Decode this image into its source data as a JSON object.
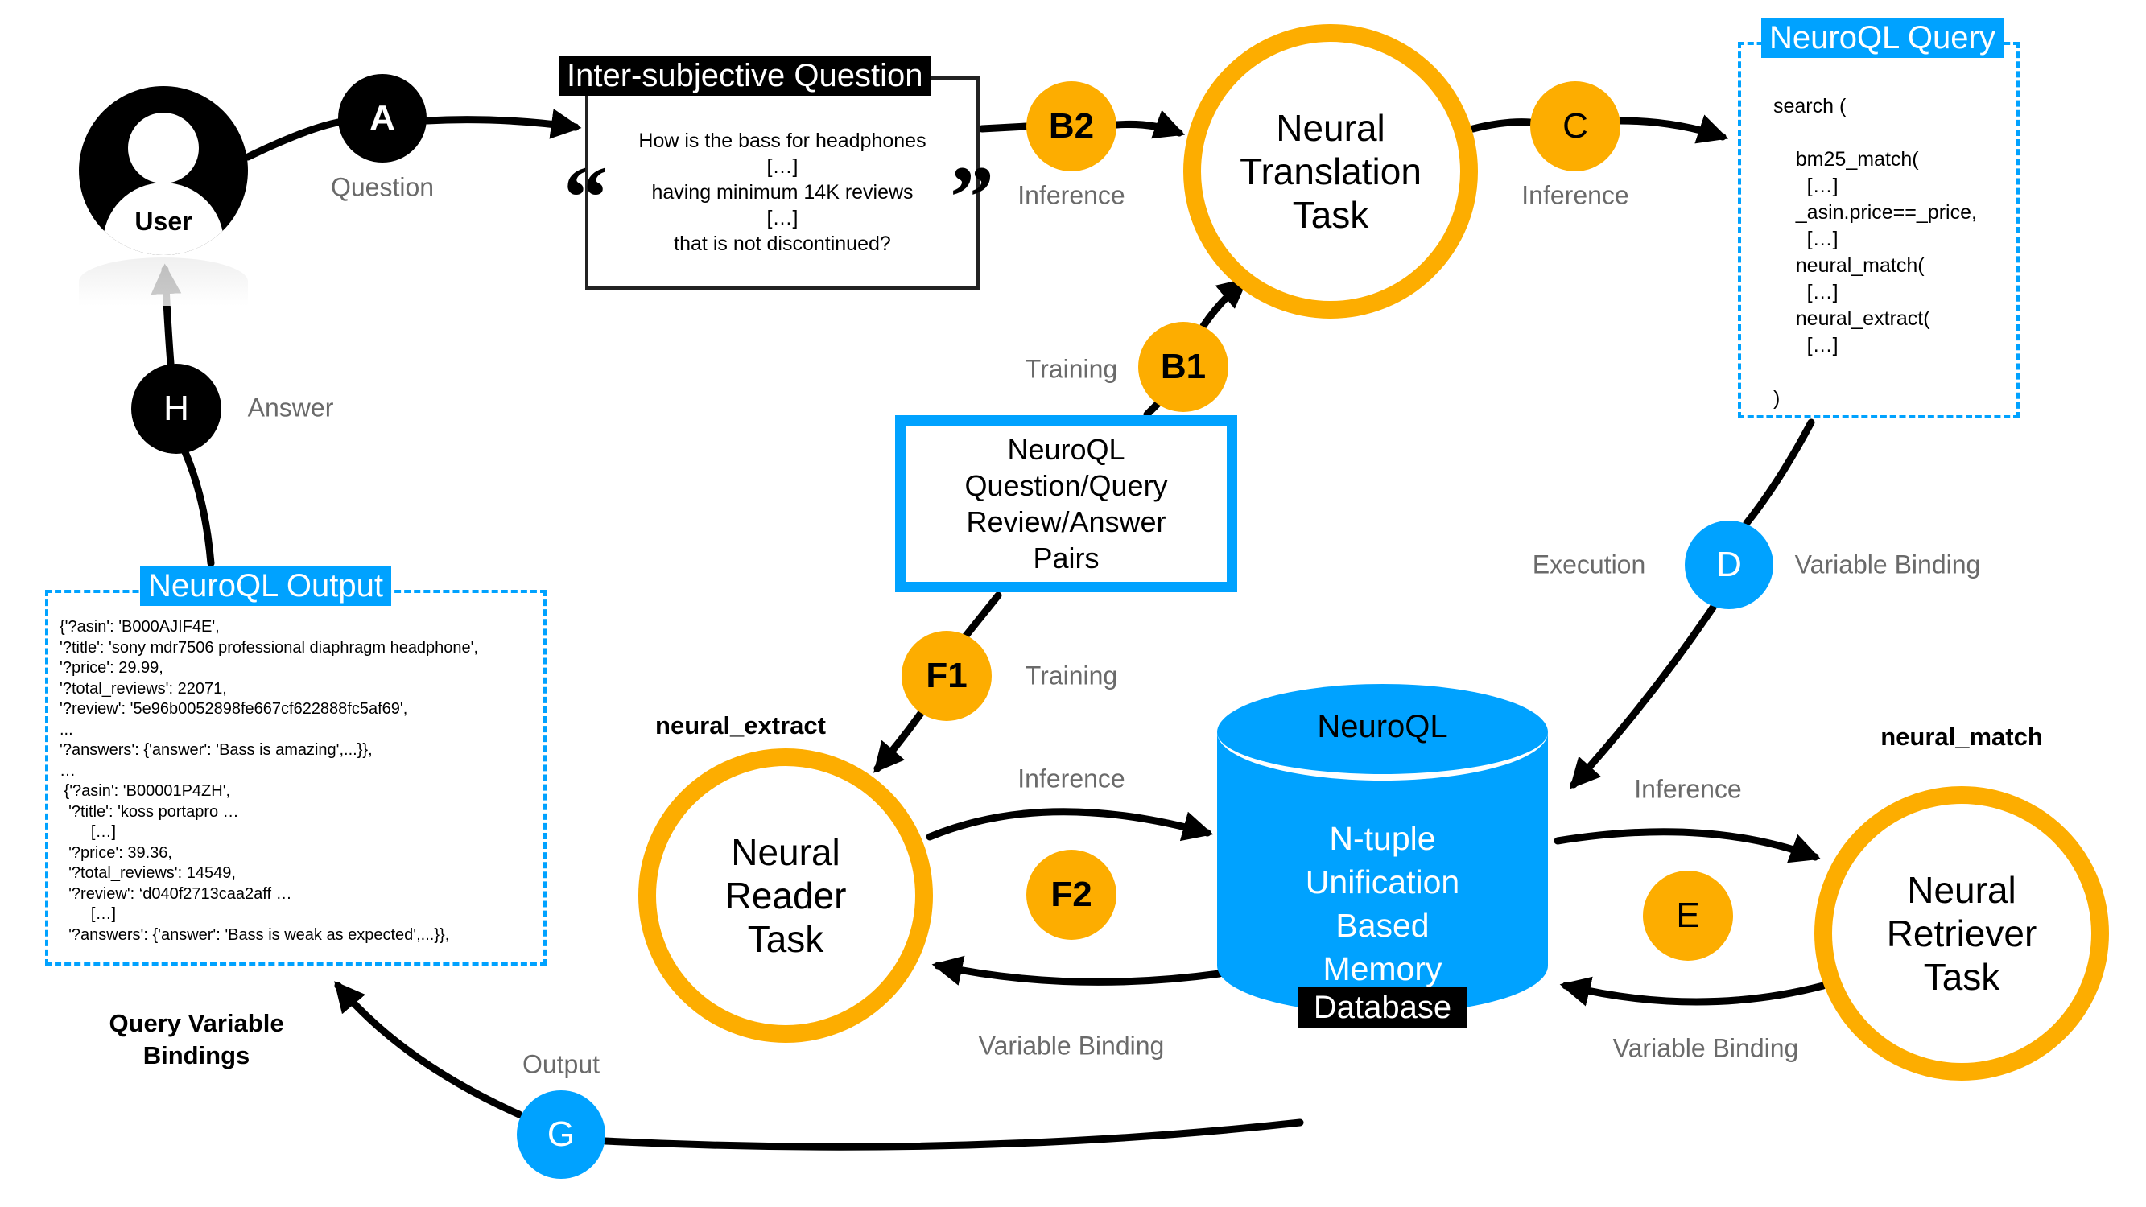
{
  "colors": {
    "orange": "#FDAD00",
    "blue": "#00A2FF",
    "black": "#000000",
    "label_gray": "#6a6a6a"
  },
  "user": {
    "label": "User",
    "icon": "user-avatar-icon"
  },
  "steps": {
    "A": {
      "letter": "A",
      "label": "Question"
    },
    "B2": {
      "letter": "B2",
      "label": "Inference"
    },
    "B1": {
      "letter": "B1",
      "label": "Training"
    },
    "C": {
      "letter": "C",
      "label": "Inference"
    },
    "D": {
      "letter": "D",
      "label_left": "Execution",
      "label_right": "Variable Binding"
    },
    "E": {
      "letter": "E",
      "label_top": "Inference",
      "label_bottom": "Variable Binding"
    },
    "F1": {
      "letter": "F1",
      "label": "Training"
    },
    "F2": {
      "letter": "F2",
      "label_top": "Inference",
      "label_bottom": "Variable Binding"
    },
    "G": {
      "letter": "G",
      "label": "Output"
    },
    "H": {
      "letter": "H",
      "label": "Answer"
    }
  },
  "question_box": {
    "title": "Inter-subjective Question",
    "open_quote": "“",
    "close_quote": "”",
    "lines": [
      "How is the bass for headphones",
      "[…]",
      "having minimum 14K reviews",
      "[…]",
      "that is not discontinued?"
    ]
  },
  "tasks": {
    "translation": "Neural\nTranslation\nTask",
    "reader": "Neural\nReader\nTask",
    "retriever": "Neural\nRetriever\nTask"
  },
  "query_box": {
    "title": "NeuroQL Query",
    "code": "search (\n\n    bm25_match(\n      […]\n    _asin.price==_price,\n      […]\n    neural_match(\n      […]\n    neural_extract(\n      […]\n\n)"
  },
  "pairs_box": {
    "lines": [
      "NeuroQL",
      "Question/Query",
      "Review/Answer",
      "Pairs"
    ]
  },
  "output_box": {
    "title": "NeuroQL Output",
    "code": "{'?asin': 'B000AJIF4E',\n'?title': 'sony mdr7506 professional diaphragm headphone',\n'?price': 29.99,\n'?total_reviews': 22071,\n'?review': '5e96b0052898fe667cf622888fc5af69',\n...\n'?answers': {'answer': 'Bass is amazing',...}},\n…\n {'?asin': 'B00001P4ZH',\n  '?title': 'koss portapro …\n       […]\n  '?price': 39.36,\n  '?total_reviews': 14549,\n  '?review': ‘d040f2713caa2aff …\n       […]\n  '?answers': {'answer': 'Bass is weak as expected',...}},"
  },
  "database": {
    "top_label": "NeuroQL",
    "body": "N-tuple\nUnification\nBased\nMemory",
    "tag": "Database"
  },
  "annotations": {
    "neural_extract": "neural_extract",
    "neural_match": "neural_match",
    "query_variable_bindings": "Query Variable\nBindings"
  }
}
